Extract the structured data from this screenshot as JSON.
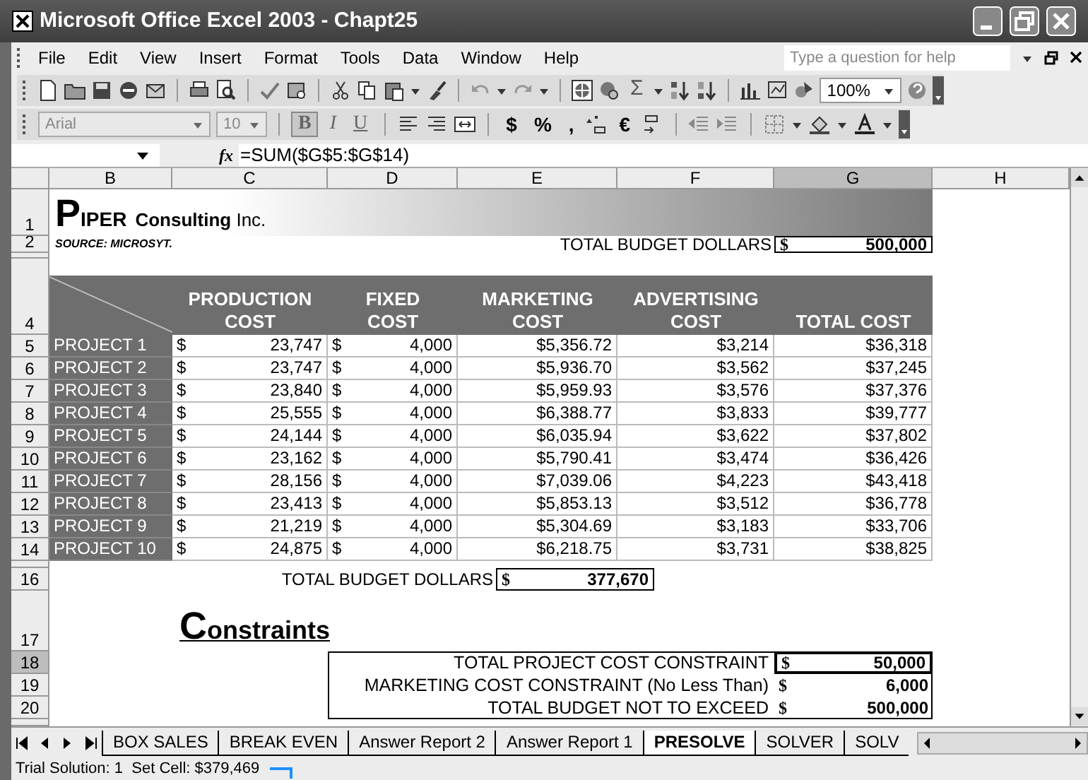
{
  "window": {
    "title": "Microsoft Office Excel 2003 - Chapt25"
  },
  "menu": [
    {
      "label": "File"
    },
    {
      "label": "Edit"
    },
    {
      "label": "View"
    },
    {
      "label": "Insert"
    },
    {
      "label": "Format"
    },
    {
      "label": "Tools"
    },
    {
      "label": "Data"
    },
    {
      "label": "Window"
    },
    {
      "label": "Help"
    }
  ],
  "help_box": {
    "placeholder": "Type a question for help"
  },
  "standard_toolbar": {
    "glyphs": [
      "Σ"
    ],
    "zoom": "100%"
  },
  "formatting_toolbar": {
    "font": "Arial",
    "size": "10",
    "glyphs": [
      "B",
      "I",
      "U",
      "$",
      "%",
      ",",
      "€"
    ]
  },
  "formula_bar": {
    "fx": "fx",
    "formula": "=SUM($G$5:$G$14)"
  },
  "columns": [
    {
      "label": "B",
      "selected": false
    },
    {
      "label": "C",
      "selected": false
    },
    {
      "label": "D",
      "selected": false
    },
    {
      "label": "E",
      "selected": false
    },
    {
      "label": "F",
      "selected": false
    },
    {
      "label": "G",
      "selected": true
    },
    {
      "label": "H",
      "selected": false
    }
  ],
  "row_numbers": [
    {
      "label": "1",
      "selected": false
    },
    {
      "label": "2",
      "selected": false
    },
    {
      "label": "4",
      "selected": false
    },
    {
      "label": "5",
      "selected": false
    },
    {
      "label": "6",
      "selected": false
    },
    {
      "label": "7",
      "selected": false
    },
    {
      "label": "8",
      "selected": false
    },
    {
      "label": "9",
      "selected": false
    },
    {
      "label": "10",
      "selected": false
    },
    {
      "label": "11",
      "selected": false
    },
    {
      "label": "12",
      "selected": false
    },
    {
      "label": "13",
      "selected": false
    },
    {
      "label": "14",
      "selected": false
    },
    {
      "label": "16",
      "selected": false
    },
    {
      "label": "17",
      "selected": false
    },
    {
      "label": "18",
      "selected": true
    },
    {
      "label": "19",
      "selected": false
    },
    {
      "label": "20",
      "selected": false
    }
  ],
  "company": {
    "initial": "P",
    "rest": "IPER",
    "word": "Consulting",
    "suffix": "Inc."
  },
  "source": "SOURCE: MICROSYT.",
  "budget": {
    "label": "TOTAL BUDGET DOLLARS",
    "currency": "$",
    "value": "500,000"
  },
  "headers": [
    "PRODUCTION COST",
    "FIXED COST",
    "MARKETING COST",
    "ADVERTISING COST",
    "TOTAL COST"
  ],
  "projects": [
    {
      "name": "PROJECT 1",
      "production": "23,747",
      "fixed": "4,000",
      "marketing": "$5,356.72",
      "advertising": "$3,214",
      "total": "$36,318"
    },
    {
      "name": "PROJECT 2",
      "production": "23,747",
      "fixed": "4,000",
      "marketing": "$5,936.70",
      "advertising": "$3,562",
      "total": "$37,245"
    },
    {
      "name": "PROJECT 3",
      "production": "23,840",
      "fixed": "4,000",
      "marketing": "$5,959.93",
      "advertising": "$3,576",
      "total": "$37,376"
    },
    {
      "name": "PROJECT 4",
      "production": "25,555",
      "fixed": "4,000",
      "marketing": "$6,388.77",
      "advertising": "$3,833",
      "total": "$39,777"
    },
    {
      "name": "PROJECT 5",
      "production": "24,144",
      "fixed": "4,000",
      "marketing": "$6,035.94",
      "advertising": "$3,622",
      "total": "$37,802"
    },
    {
      "name": "PROJECT 6",
      "production": "23,162",
      "fixed": "4,000",
      "marketing": "$5,790.41",
      "advertising": "$3,474",
      "total": "$36,426"
    },
    {
      "name": "PROJECT 7",
      "production": "28,156",
      "fixed": "4,000",
      "marketing": "$7,039.06",
      "advertising": "$4,223",
      "total": "$43,418"
    },
    {
      "name": "PROJECT 8",
      "production": "23,413",
      "fixed": "4,000",
      "marketing": "$5,853.13",
      "advertising": "$3,512",
      "total": "$36,778"
    },
    {
      "name": "PROJECT 9",
      "production": "21,219",
      "fixed": "4,000",
      "marketing": "$5,304.69",
      "advertising": "$3,183",
      "total": "$33,706"
    },
    {
      "name": "PROJECT 10",
      "production": "24,875",
      "fixed": "4,000",
      "marketing": "$6,218.75",
      "advertising": "$3,731",
      "total": "$38,825"
    }
  ],
  "project_currency": "$",
  "total_budget": {
    "label": "TOTAL BUDGET DOLLARS",
    "currency": "$",
    "value": "377,670"
  },
  "constraints_heading": {
    "initial": "C",
    "rest": "onstraints"
  },
  "constraints": [
    {
      "label": "TOTAL PROJECT COST CONSTRAINT",
      "currency": "$",
      "value": "50,000",
      "selected": true
    },
    {
      "label": "MARKETING COST CONSTRAINT (No Less Than)",
      "currency": "$",
      "value": "6,000",
      "selected": false
    },
    {
      "label": "TOTAL BUDGET NOT TO EXCEED",
      "currency": "$",
      "value": "500,000",
      "selected": false
    }
  ],
  "sheet_tabs": [
    {
      "label": "BOX SALES",
      "selected": false
    },
    {
      "label": "BREAK EVEN",
      "selected": false
    },
    {
      "label": "Answer Report 2",
      "selected": false
    },
    {
      "label": "Answer Report 1",
      "selected": false
    },
    {
      "label": "PRESOLVE",
      "selected": true
    },
    {
      "label": "SOLVER",
      "selected": false
    },
    {
      "label": "SOLV",
      "selected": false
    }
  ],
  "status_bar": {
    "text": "Trial Solution: 1  Set Cell: $379,469"
  }
}
